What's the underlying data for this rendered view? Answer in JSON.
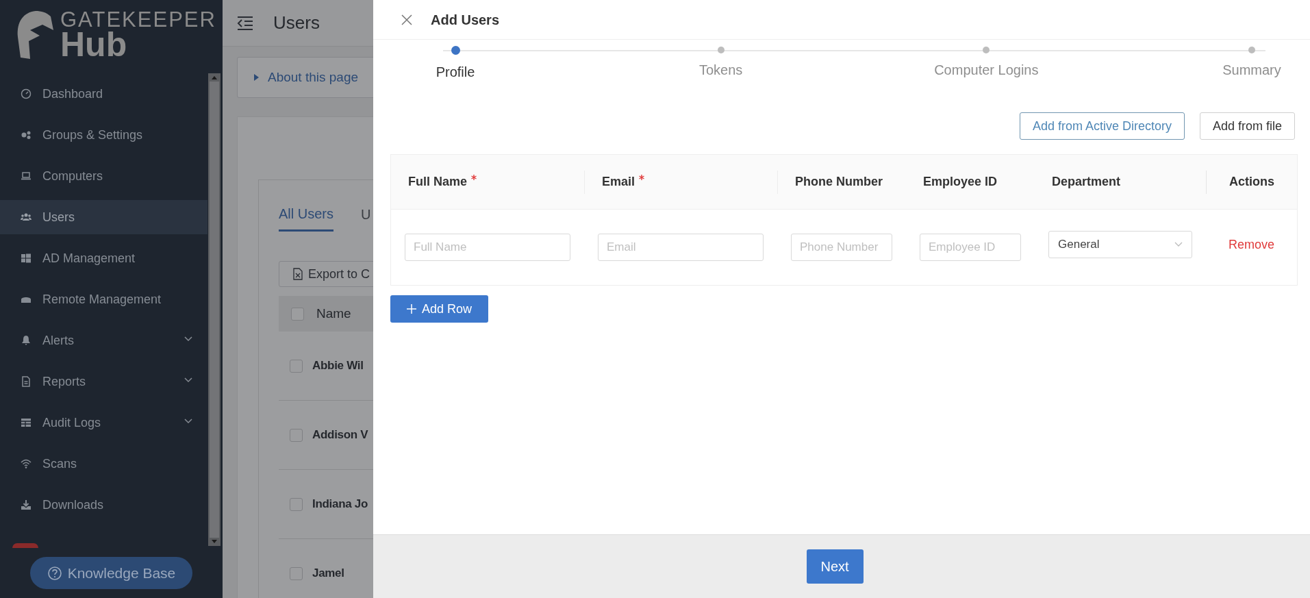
{
  "sidebar": {
    "logo": {
      "line_1": "GATEKEEPER",
      "line_2": "Hub"
    },
    "items": [
      {
        "label": "Dashboard",
        "selected": false,
        "expandable": false
      },
      {
        "label": "Groups & Settings",
        "selected": false,
        "expandable": false
      },
      {
        "label": "Computers",
        "selected": false,
        "expandable": false
      },
      {
        "label": "Users",
        "selected": true,
        "expandable": false
      },
      {
        "label": "AD Management",
        "selected": false,
        "expandable": false
      },
      {
        "label": "Remote Management",
        "selected": false,
        "expandable": false
      },
      {
        "label": "Alerts",
        "selected": false,
        "expandable": true
      },
      {
        "label": "Reports",
        "selected": false,
        "expandable": true
      },
      {
        "label": "Audit Logs",
        "selected": false,
        "expandable": true
      },
      {
        "label": "Scans",
        "selected": false,
        "expandable": false
      },
      {
        "label": "Downloads",
        "selected": false,
        "expandable": false
      }
    ],
    "help_button": "Knowledge Base"
  },
  "page": {
    "title": "Users",
    "about": "About this page",
    "tabs": [
      {
        "label": "All Users",
        "selected": true
      },
      {
        "label": "U",
        "selected": false
      }
    ],
    "export_button": "Export to C",
    "table": {
      "columns": [
        "Name"
      ],
      "all_checked": false,
      "rows": [
        {
          "name": "Abbie Wil",
          "checked": false
        },
        {
          "name": "Addison V",
          "checked": false
        },
        {
          "name": "Indiana Jo",
          "checked": false
        },
        {
          "name": "Jamel",
          "checked": false
        }
      ]
    }
  },
  "drawer": {
    "title": "Add Users",
    "steps": [
      {
        "label": "Profile",
        "selected": true
      },
      {
        "label": "Tokens",
        "selected": false
      },
      {
        "label": "Computer Logins",
        "selected": false
      },
      {
        "label": "Summary",
        "selected": false
      }
    ],
    "actions": [
      "Add from Active Directory",
      "Add from file"
    ],
    "columns": [
      {
        "label": "Full Name",
        "required": true
      },
      {
        "label": "Email",
        "required": true
      },
      {
        "label": "Phone Number",
        "required": false
      },
      {
        "label": "Employee ID",
        "required": false
      },
      {
        "label": "Department",
        "required": false
      },
      {
        "label": "Actions",
        "required": false
      }
    ],
    "row": {
      "fields": [
        {
          "placeholder": "Full Name"
        },
        {
          "placeholder": "Email"
        },
        {
          "placeholder": "Phone Number"
        },
        {
          "placeholder": "Employee ID"
        }
      ],
      "department": "General",
      "remove": "Remove"
    },
    "add_row": "Add Row",
    "next": "Next"
  }
}
